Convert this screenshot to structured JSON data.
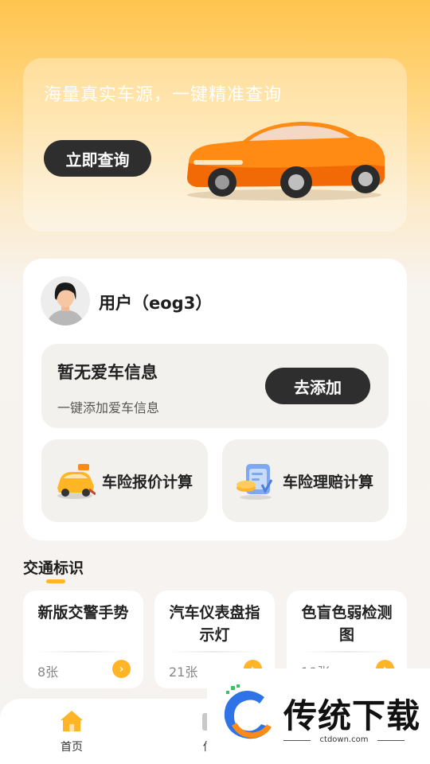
{
  "banner": {
    "title": "海量真实车源，一键精准查询",
    "button_label": "立即查询"
  },
  "user": {
    "name": "用户（eog3）"
  },
  "car_info": {
    "title": "暂无爱车信息",
    "subtitle": "一键添加爱车信息",
    "add_button_label": "去添加"
  },
  "tools": [
    {
      "label": "车险报价计算",
      "icon": "car-quote-icon"
    },
    {
      "label": "车险理赔计算",
      "icon": "claim-document-icon"
    }
  ],
  "traffic_signs": {
    "title": "交通标识",
    "items": [
      {
        "title": "新版交警手势",
        "count": "8张"
      },
      {
        "title": "汽车仪表盘指示灯",
        "count": "21张"
      },
      {
        "title": "色盲色弱检测图",
        "count": "19张"
      }
    ]
  },
  "bottom_nav": {
    "home_label": "首页",
    "second_label": "估"
  },
  "watermark": {
    "text": "传统下载",
    "sub": "ctdown.com"
  },
  "colors": {
    "accent": "#FFB526",
    "button_dark": "#2E2E2E",
    "card_gray": "#F3F1EE"
  }
}
